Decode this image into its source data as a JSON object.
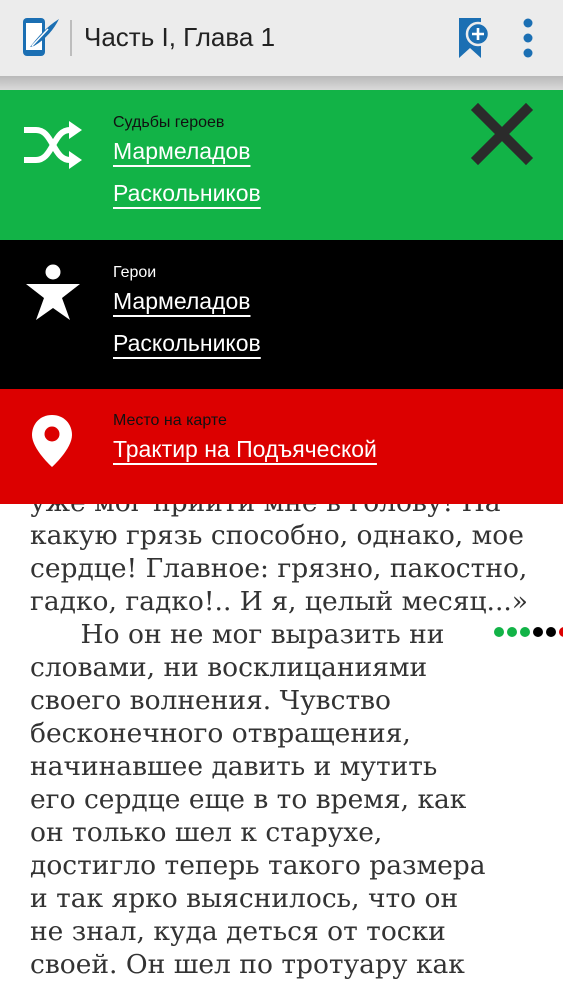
{
  "header": {
    "title": "Часть I, Глава 1"
  },
  "panels": {
    "fates": {
      "label": "Судьбы героев",
      "links": [
        "Мармеладов",
        "Раскольников"
      ]
    },
    "heroes": {
      "label": "Герои",
      "links": [
        "Мармеладов",
        "Раскольников"
      ]
    },
    "place": {
      "label": "Место на карте",
      "links": [
        "Трактир на Подъяческой"
      ]
    }
  },
  "reader": {
    "lines": [
      "уже мог прийти мне в голову! На",
      "какую грязь способно, однако, мое",
      "сердце! Главное: грязно, пакостно,",
      "гадко, гадко!.. И я, целый месяц...»",
      "      Но он не мог выразить ни",
      "словами, ни восклицаниями",
      "своего волнения. Чувство",
      "бесконечного отвращения,",
      "начинавшее давить и мутить",
      "его сердце еще в то время, как",
      "он только шел к старухе,",
      "достигло теперь такого размера",
      "и так ярко выяснилось, что он",
      "не знал, куда деться от тоски",
      "своей. Он шел по тротуару как"
    ]
  },
  "colors": {
    "green": "#12b347",
    "black": "#000000",
    "red": "#dc0000",
    "dots": [
      "#12b347",
      "#12b347",
      "#12b347",
      "#000000",
      "#000000",
      "#dc0000"
    ]
  }
}
